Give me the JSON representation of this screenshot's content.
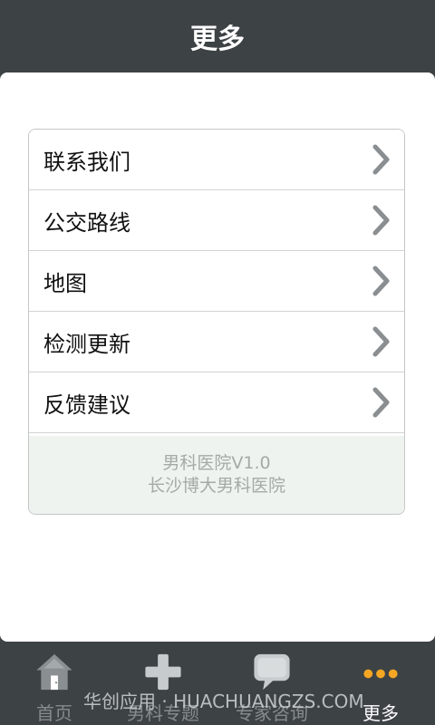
{
  "header": {
    "title": "更多"
  },
  "menu": {
    "items": [
      {
        "label": "联系我们"
      },
      {
        "label": "公交路线"
      },
      {
        "label": "地图"
      },
      {
        "label": "检测更新"
      },
      {
        "label": "反馈建议"
      }
    ],
    "info_line1": "男科医院V1.0",
    "info_line2": "长沙博大男科医院"
  },
  "tabbar": {
    "tabs": [
      {
        "label": "首页",
        "icon": "home-icon"
      },
      {
        "label": "男科专题",
        "icon": "plus-icon"
      },
      {
        "label": "专家咨询",
        "icon": "chat-bubble-icon"
      },
      {
        "label": "更多",
        "icon": "more-dots-icon",
        "active": true
      }
    ]
  },
  "watermark": "华创应用 · HUACHUANGZS.COM",
  "colors": {
    "bar": "#3d4245",
    "active_tab_icon": "#f5a623",
    "info_bg": "#eef3ef"
  }
}
